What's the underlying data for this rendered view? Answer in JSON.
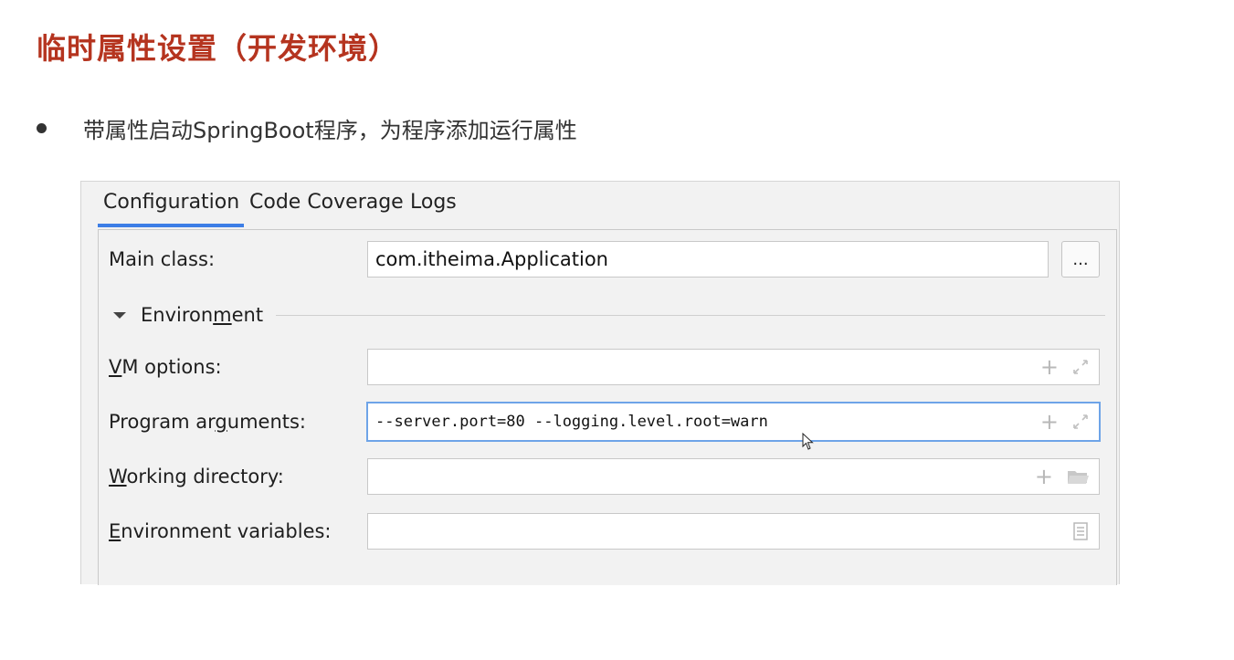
{
  "slide": {
    "title": "临时属性设置（开发环境）",
    "bullet": "带属性启动SpringBoot程序，为程序添加运行属性"
  },
  "tabs": [
    {
      "label": "Configuration",
      "active": true
    },
    {
      "label": "Code Coverage",
      "active": false
    },
    {
      "label": "Logs",
      "active": false
    }
  ],
  "form": {
    "main_class": {
      "label": "Main class:",
      "value": "com.itheima.Application",
      "browse_label": "..."
    },
    "environment_section": {
      "label_pre": "Environ",
      "label_mnemonic": "m",
      "label_post": "ent",
      "expanded": true
    },
    "vm_options": {
      "label_mnemonic": "V",
      "label_rest": "M options:",
      "value": ""
    },
    "program_arguments": {
      "label_pre": "Program ar",
      "label_mnemonic": "g",
      "label_post": "uments:",
      "value": "--server.port=80 --logging.level.root=warn"
    },
    "working_directory": {
      "label_mnemonic": "W",
      "label_rest": "orking directory:",
      "value": ""
    },
    "environment_variables": {
      "label_mnemonic": "E",
      "label_rest": "nvironment variables:",
      "value": ""
    }
  },
  "icons": {
    "add": "plus-icon",
    "expand": "expand-icon",
    "folder": "folder-icon",
    "document": "document-icon",
    "toggle": "triangle-down-icon"
  },
  "colors": {
    "title": "#b5341f",
    "tab_underline": "#3d7ee6",
    "focus_border": "#6ea4e8"
  }
}
